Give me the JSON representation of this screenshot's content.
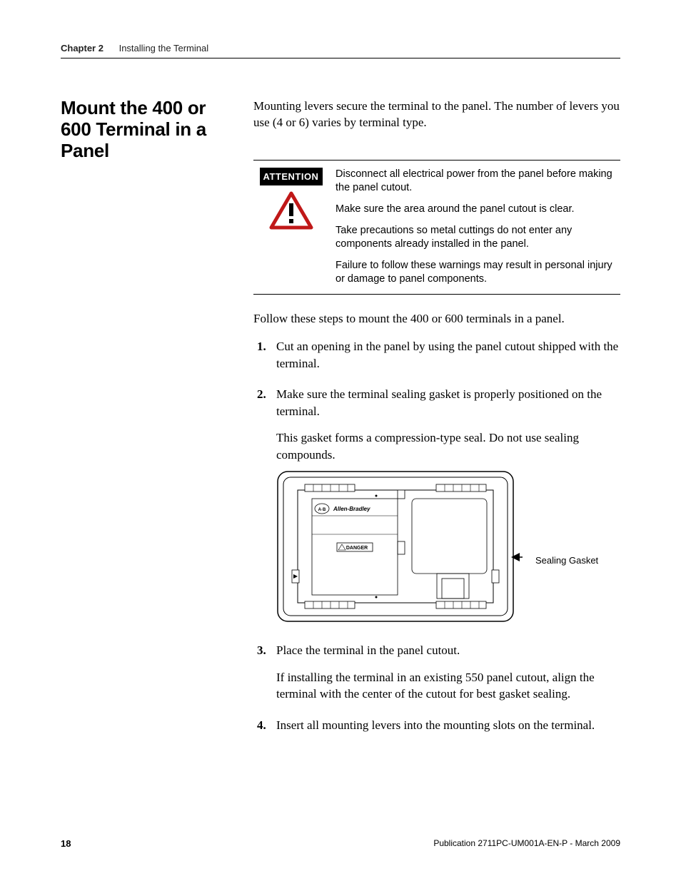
{
  "header": {
    "chapter": "Chapter 2",
    "title": "Installing the Terminal"
  },
  "sidehead": "Mount the 400 or 600 Terminal in a Panel",
  "intro": "Mounting levers secure the terminal to the panel. The number of levers you use (4 or 6) varies by terminal type.",
  "attention": {
    "label": "ATTENTION",
    "paras": [
      "Disconnect all electrical power from the panel before making the panel cutout.",
      "Make sure the area around the panel cutout is clear.",
      "Take precautions so metal cuttings do not enter any components already installed in the panel.",
      "Failure to follow these warnings may result in personal injury or damage to panel components."
    ]
  },
  "lead": "Follow these steps to mount the 400 or 600 terminals in a panel.",
  "steps": {
    "s1": "Cut an opening in the panel by using the panel cutout shipped with the terminal.",
    "s2": "Make sure the terminal sealing gasket is properly positioned on the terminal.",
    "s2_note": "This gasket forms a compression-type seal. Do not use sealing compounds.",
    "s3": "Place the terminal in the panel cutout.",
    "s3_note": "If installing the terminal in an existing 550 panel cutout, align the terminal with the center of the cutout for best gasket sealing.",
    "s4": "Insert all mounting levers into the mounting slots on the terminal."
  },
  "figure": {
    "callout": "Sealing Gasket",
    "brand": "Allen-Bradley",
    "badge": "A·B",
    "danger": "DANGER"
  },
  "footer": {
    "page": "18",
    "pub": "Publication 2711PC-UM001A-EN-P - March 2009"
  }
}
